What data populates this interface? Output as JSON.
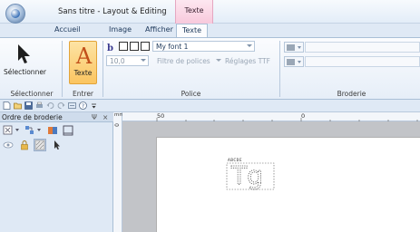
{
  "window": {
    "title": "Sans titre - Layout & Editing",
    "context_tab_group": "Texte"
  },
  "tabs": [
    {
      "label": "Accueil"
    },
    {
      "label": "Image"
    },
    {
      "label": "Afficher"
    },
    {
      "label": "Texte",
      "active": true
    }
  ],
  "ribbon": {
    "groups": {
      "selection": "Sélectionner",
      "entry": "Entrer",
      "font": "Police",
      "embroidery": "Broderie"
    },
    "select_button": "Sélectionner",
    "text_button": "Texte",
    "font_name": "My font 1",
    "font_size": "10,0",
    "font_filter": "Filtre de polices",
    "ttf_settings": "Réglages TTF"
  },
  "pane": {
    "title": "Ordre de broderie",
    "pin": "Ψ",
    "close": "×"
  },
  "ruler": {
    "unit": "mm",
    "h_labels": [
      "50",
      "0"
    ],
    "v_label": "0"
  },
  "canvas": {
    "text_object": "Tg",
    "small_label": "ABCDE"
  },
  "colors": {
    "accent_orange": "#fbc561",
    "ribbon_bg": "#e6eef8",
    "context_pink": "#f8c9dc"
  }
}
